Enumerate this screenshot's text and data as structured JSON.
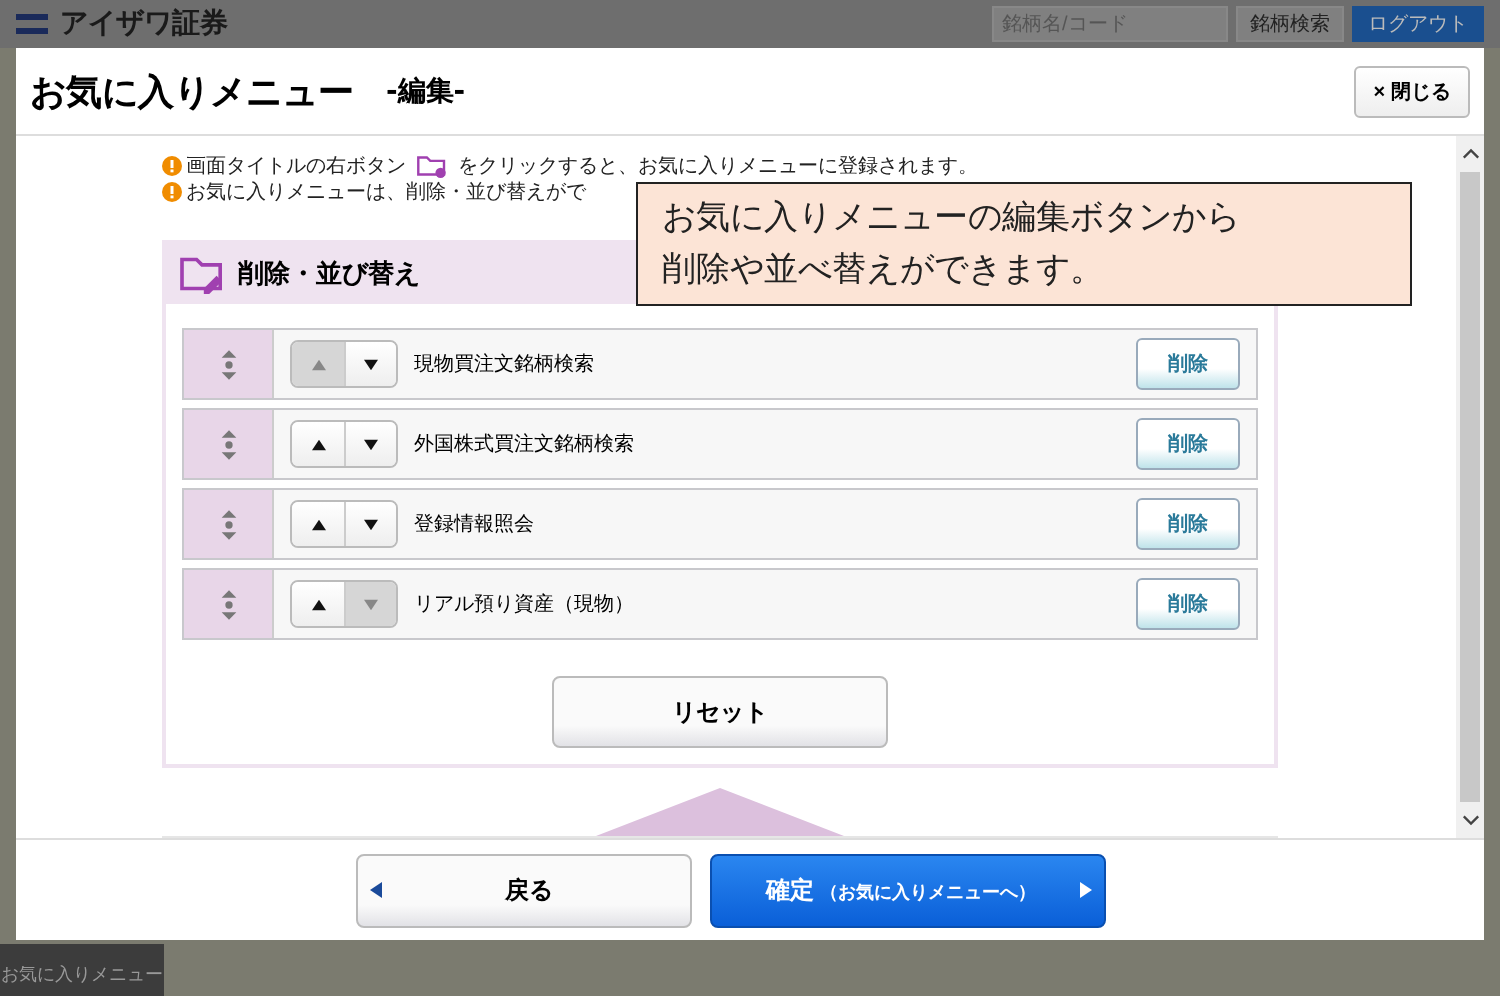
{
  "header": {
    "logo": "アイザワ証券",
    "search": {
      "placeholder": "銘柄名/コード"
    },
    "search_button": "銘柄検索",
    "logout_button": "ログアウト"
  },
  "dialog": {
    "title": "お気に入りメニュー",
    "subtitle": "-編集-",
    "close_button": "× 閉じる"
  },
  "notes": [
    {
      "text": "画面タイトルの右ボタン",
      "text_after": "をクリックすると、お気に入りメニューに登録されます。"
    },
    {
      "text": "お気に入りメニューは、削除・並び替えがで"
    }
  ],
  "callout": [
    "お気に入りメニューの編集ボタンから",
    "削除や並べ替えができます。"
  ],
  "section": {
    "title": "削除・並び替え",
    "items": [
      {
        "label": "現物買注文銘柄検索",
        "up_disabled": true,
        "down_disabled": false,
        "delete_button": "削除"
      },
      {
        "label": "外国株式買注文銘柄検索",
        "up_disabled": false,
        "down_disabled": false,
        "delete_button": "削除"
      },
      {
        "label": "登録情報照会",
        "up_disabled": false,
        "down_disabled": false,
        "delete_button": "削除"
      },
      {
        "label": "リアル預り資産（現物）",
        "up_disabled": false,
        "down_disabled": true,
        "delete_button": "削除"
      }
    ],
    "reset_button": "リセット"
  },
  "footer": {
    "back_button": "戻る",
    "confirm_button": "確定",
    "confirm_note": "（お気に入りメニューへ）"
  },
  "dock": {
    "label": "お気に入りメニュー"
  }
}
